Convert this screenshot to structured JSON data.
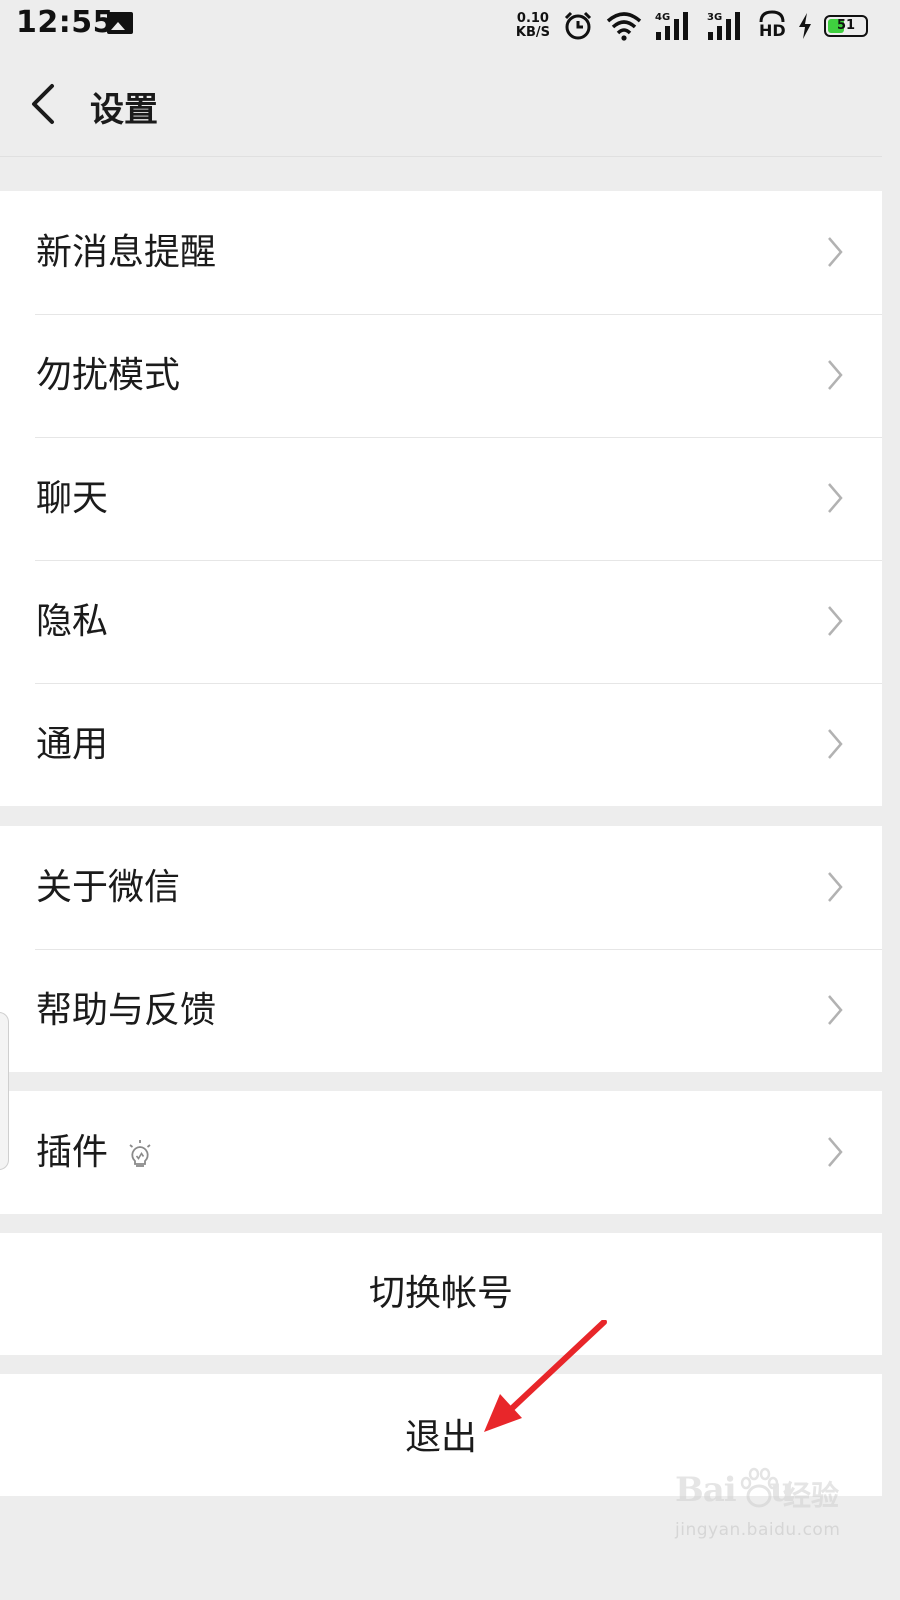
{
  "status_bar": {
    "time": "12:55",
    "net_speed": "0.10",
    "net_speed_unit": "KB/S",
    "sig1_label": "4G",
    "sig2_label": "3G",
    "hd_label": "HD",
    "battery_percent": "51",
    "battery_level": 0.51,
    "battery_color": "#3fcf3f"
  },
  "header": {
    "title": "设置"
  },
  "groups": [
    {
      "items": [
        "新消息提醒",
        "勿扰模式",
        "聊天",
        "隐私",
        "通用"
      ]
    },
    {
      "items": [
        "关于微信",
        "帮助与反馈"
      ]
    },
    {
      "items": [
        "插件"
      ]
    }
  ],
  "actions": {
    "switch_account": "切换帐号",
    "logout": "退出"
  },
  "annotation": {
    "arrow_color": "#e8262a"
  },
  "watermark": {
    "logo_text": "Bai",
    "logo_text2": "u",
    "brand_cn": "经验",
    "url": "jingyan.baidu.com"
  }
}
